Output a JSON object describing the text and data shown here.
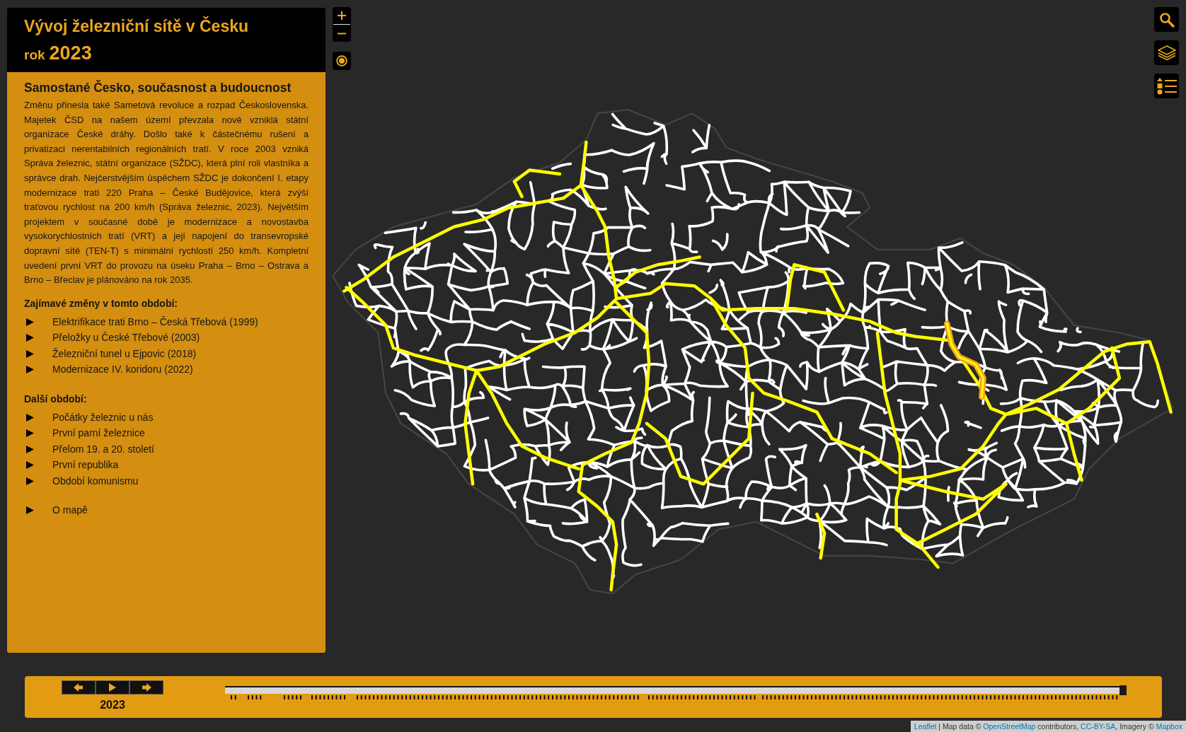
{
  "header": {
    "title": "Vývoj železniční sítě v Česku",
    "year_label": "rok",
    "year": "2023"
  },
  "article": {
    "heading": "Samostané Česko, současnost a budoucnost",
    "text": "Změnu přinesla také Sametová revoluce a rozpad Československa. Majetek ČSD na našem území převzala nově vzniklá státní organizace České dráhy. Došlo také k částečnému rušení a privatizaci nerentabilních regionálních tratí. V roce 2003 vzniká Správa železnic, státní organizace (SŽDC), která plní roli vlastníka a správce drah. Nejčerstvějším úspěchem SŽDC je dokončení I. etapy modernizace trati 220 Praha – České Budějovice, která zvýší traťovou rychlost na 200 km/h (Správa železnic, 2023). Největším projektem v současné době je modernizace a novostavba vysokorychlostních tratí (VRT) a její napojení do transevropské dopravní sítě (TEN-T) s minimální rychlostí 250 km/h. Kompletní uvedení první VRT do provozu na úseku Praha – Brno – Ostrava a Brno – Břeclav je plánováno na rok 2035."
  },
  "changes": {
    "heading": "Zajímavé změny v tomto období:",
    "items": [
      "Elektrifikace trati Brno – Česká Třebová (1999)",
      "Přeložky u České Třebové (2003)",
      "Železniční tunel u Ejpovic (2018)",
      "Modernizace IV. koridoru (2022)"
    ]
  },
  "other_periods": {
    "heading": "Další období:",
    "items": [
      "Počátky železnic u nás",
      "První parní železnice",
      "Přelom 19. a 20. století",
      "První republika",
      "Období komunismu"
    ]
  },
  "about": {
    "label": "O mapě"
  },
  "timeline": {
    "year": "2023",
    "level": 1
  },
  "attribution": {
    "parts": [
      {
        "kind": "link",
        "text": "Leaflet"
      },
      {
        "kind": "text",
        "text": " | Map data © "
      },
      {
        "kind": "link",
        "text": "OpenStreetMap"
      },
      {
        "kind": "text",
        "text": " contributors, "
      },
      {
        "kind": "link",
        "text": "CC-BY-SA"
      },
      {
        "kind": "text",
        "text": ", Imagery © "
      },
      {
        "kind": "link",
        "text": "Mapbox"
      }
    ]
  }
}
